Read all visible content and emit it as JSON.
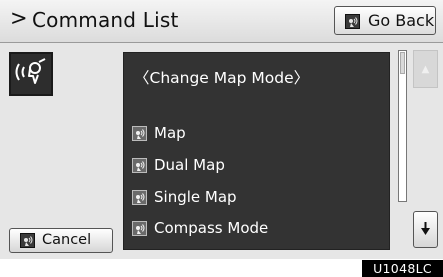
{
  "header": {
    "chevron": ">",
    "title": "Command List",
    "go_back_label": "Go Back"
  },
  "list": {
    "heading": "〈Change Map Mode〉",
    "items": [
      {
        "label": "Map"
      },
      {
        "label": "Dual Map"
      },
      {
        "label": "Single Map"
      },
      {
        "label": "Compass Mode"
      }
    ]
  },
  "scrollbar": {
    "up_glyph": "▲",
    "down_glyph": "▼",
    "position_fraction": 0
  },
  "footer": {
    "cancel_label": "Cancel"
  },
  "figure_code": "U1048LC",
  "icons": {
    "voice_big": "voice-command-icon",
    "voice_small": "voice-command-icon"
  },
  "colors": {
    "panel": "#333333",
    "screen": "#e6e6e6",
    "header": "#e8e8e8"
  }
}
